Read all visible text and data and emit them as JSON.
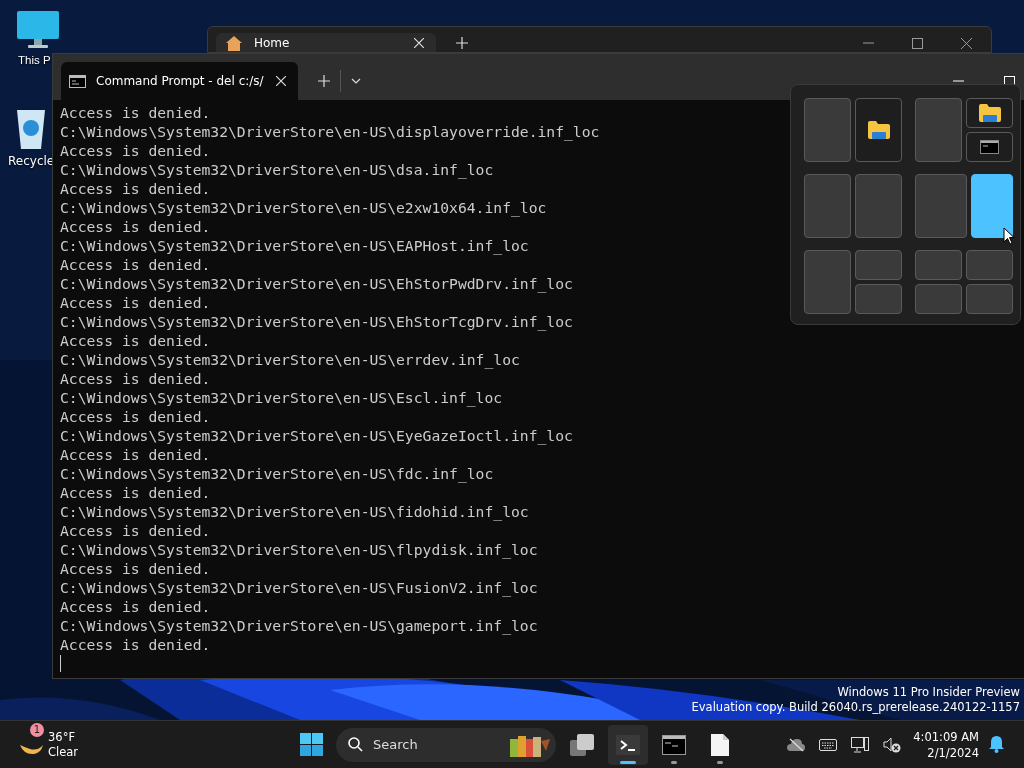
{
  "desktop_icons": [
    {
      "kind": "monitor",
      "label": "This P"
    },
    {
      "kind": "bin",
      "label": "Recycle"
    }
  ],
  "back_window": {
    "tab": {
      "label": "Home"
    }
  },
  "terminal": {
    "tab": {
      "label": "Command Prompt - del  c:/s/"
    },
    "lines": [
      "Access is denied.",
      "C:\\Windows\\System32\\DriverStore\\en-US\\displayoverride.inf_loc",
      "Access is denied.",
      "C:\\Windows\\System32\\DriverStore\\en-US\\dsa.inf_loc",
      "Access is denied.",
      "C:\\Windows\\System32\\DriverStore\\en-US\\e2xw10x64.inf_loc",
      "Access is denied.",
      "C:\\Windows\\System32\\DriverStore\\en-US\\EAPHost.inf_loc",
      "Access is denied.",
      "C:\\Windows\\System32\\DriverStore\\en-US\\EhStorPwdDrv.inf_loc",
      "Access is denied.",
      "C:\\Windows\\System32\\DriverStore\\en-US\\EhStorTcgDrv.inf_loc",
      "Access is denied.",
      "C:\\Windows\\System32\\DriverStore\\en-US\\errdev.inf_loc",
      "Access is denied.",
      "C:\\Windows\\System32\\DriverStore\\en-US\\Escl.inf_loc",
      "Access is denied.",
      "C:\\Windows\\System32\\DriverStore\\en-US\\EyeGazeIoctl.inf_loc",
      "Access is denied.",
      "C:\\Windows\\System32\\DriverStore\\en-US\\fdc.inf_loc",
      "Access is denied.",
      "C:\\Windows\\System32\\DriverStore\\en-US\\fidohid.inf_loc",
      "Access is denied.",
      "C:\\Windows\\System32\\DriverStore\\en-US\\flpydisk.inf_loc",
      "Access is denied.",
      "C:\\Windows\\System32\\DriverStore\\en-US\\FusionV2.inf_loc",
      "Access is denied.",
      "C:\\Windows\\System32\\DriverStore\\en-US\\gameport.inf_loc",
      "Access is denied."
    ]
  },
  "snap_layouts": [
    {
      "kind": "halves",
      "zones": [
        {
          "kind": "empty",
          "selected": false
        },
        {
          "kind": "folder",
          "selected": false
        }
      ]
    },
    {
      "kind": "half-stack",
      "zones": [
        {
          "kind": "empty",
          "selected": false
        },
        {
          "kind": "folder",
          "selected": false
        },
        {
          "kind": "console",
          "selected": false
        }
      ]
    },
    {
      "kind": "halves",
      "zones": [
        {
          "kind": "empty",
          "selected": false
        },
        {
          "kind": "empty",
          "selected": false
        }
      ]
    },
    {
      "kind": "wide-narrow",
      "zones": [
        {
          "kind": "empty",
          "selected": false
        },
        {
          "kind": "empty",
          "selected": true
        }
      ]
    },
    {
      "kind": "half-stack",
      "zones": [
        {
          "kind": "empty",
          "selected": false
        },
        {
          "kind": "empty",
          "selected": false
        },
        {
          "kind": "empty",
          "selected": false
        }
      ]
    },
    {
      "kind": "quad",
      "zones": [
        {
          "kind": "empty",
          "selected": false
        },
        {
          "kind": "empty",
          "selected": false
        },
        {
          "kind": "empty",
          "selected": false
        },
        {
          "kind": "empty",
          "selected": false
        }
      ]
    }
  ],
  "watermark": {
    "lines": [
      "Windows 11 Pro Insider Preview",
      "Evaluation copy. Build 26040.rs_prerelease.240122-1157"
    ]
  },
  "taskbar": {
    "weather": {
      "badge": "1",
      "temperature": "36°F",
      "condition": "Clear"
    },
    "search": {
      "placeholder": "Search"
    },
    "apps": [
      {
        "kind": "taskview",
        "active": false,
        "running": false
      },
      {
        "kind": "terminal",
        "active": true,
        "running": true
      },
      {
        "kind": "cmd",
        "active": false,
        "running": true
      },
      {
        "kind": "file",
        "active": false,
        "running": true
      }
    ],
    "clock": {
      "time": "4:01:09 AM",
      "date": "2/1/2024"
    }
  }
}
